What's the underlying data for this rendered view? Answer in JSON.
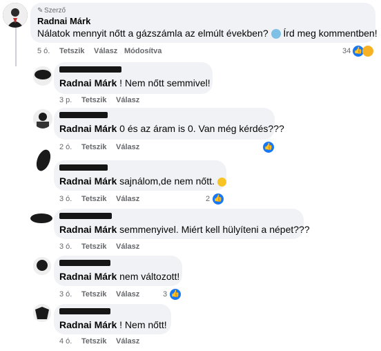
{
  "post": {
    "author_badge": "Szerző",
    "author": "Radnai Márk",
    "text": "Nálatok mennyit nőtt a gázszámla az elmúlt években?",
    "text_cta": "Írd meg kommentben!",
    "time": "5 ó.",
    "like": "Tetszik",
    "reply": "Válasz",
    "edited": "Módosítva",
    "reaction_count": "34"
  },
  "replies": [
    {
      "author": "Radnai Márk",
      "text": "! Nem nőtt semmivel!",
      "time": "3 p.",
      "like": "Tetszik",
      "reply": "Válasz",
      "reaction_count": ""
    },
    {
      "author": "Radnai Márk",
      "text": "0 és az áram is 0. Van még kérdés???",
      "time": "2 ó.",
      "like": "Tetszik",
      "reply": "Válasz",
      "reaction_count": ""
    },
    {
      "author": "Radnai Márk",
      "text": "sajnálom,de nem nőtt.",
      "time": "3 ó.",
      "like": "Tetszik",
      "reply": "Válasz",
      "reaction_count": "2"
    },
    {
      "author": "Radnai Márk",
      "text": "semmenyivel. Miért kell hülyíteni a népet???",
      "time": "3 ó.",
      "like": "Tetszik",
      "reply": "Válasz",
      "reaction_count": ""
    },
    {
      "author": "Radnai Márk",
      "text": "nem változott!",
      "time": "3 ó.",
      "like": "Tetszik",
      "reply": "Válasz",
      "reaction_count": "3"
    },
    {
      "author": "Radnai Márk",
      "text": "! Nem nőtt!",
      "time": "4 ó.",
      "like": "Tetszik",
      "reply": "Válasz",
      "reaction_count": ""
    }
  ],
  "icons": {
    "like": "like-icon",
    "haha": "haha-icon",
    "pencil": "pencil-icon",
    "emoji_sad": "sad-face-icon",
    "emoji_smile": "smile-face-icon"
  },
  "colors": {
    "like_blue": "#1877f2",
    "bubble": "#f0f2f5",
    "meta": "#65676b"
  }
}
